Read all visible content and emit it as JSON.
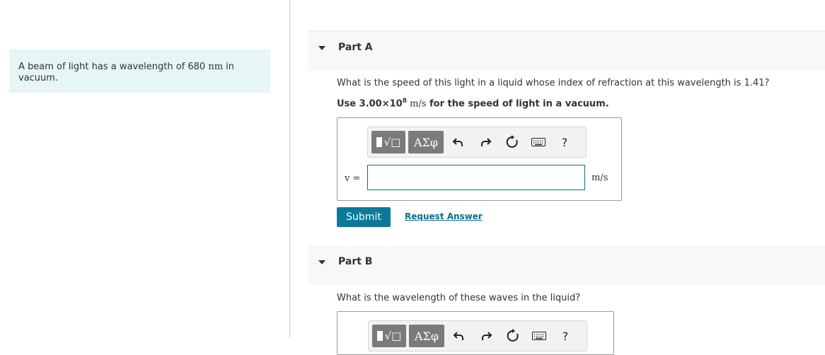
{
  "problem": {
    "text_before": "A beam of light has a wavelength of 680 ",
    "unit_nm": "nm",
    "text_after": " in vacuum."
  },
  "part_a": {
    "title": "Part A",
    "question": "What is the speed of this light in a liquid whose index of refraction at this wavelength is 1.41?",
    "instruction_prefix": "Use 3.00×10",
    "instruction_exponent": "8",
    "instruction_unit": " m/s",
    "instruction_suffix": " for the speed of light in a vacuum.",
    "variable_label": "v =",
    "answer_value": "",
    "unit": "m/s",
    "submit_label": "Submit",
    "request_label": "Request Answer"
  },
  "part_b": {
    "title": "Part B",
    "question": "What is the wavelength of these waves in the liquid?"
  },
  "toolbar": {
    "templates_icon": "templates-root-icon",
    "greek_label": "ΑΣφ",
    "undo_icon": "undo-icon",
    "redo_icon": "redo-icon",
    "reset_icon": "reset-icon",
    "keyboard_icon": "keyboard-icon",
    "help_label": "?"
  },
  "colors": {
    "accent": "#0a7a9a",
    "problem_bg": "#e6f6f5",
    "toolbar_button": "#7a7a7a",
    "input_border": "#0d6e73"
  }
}
